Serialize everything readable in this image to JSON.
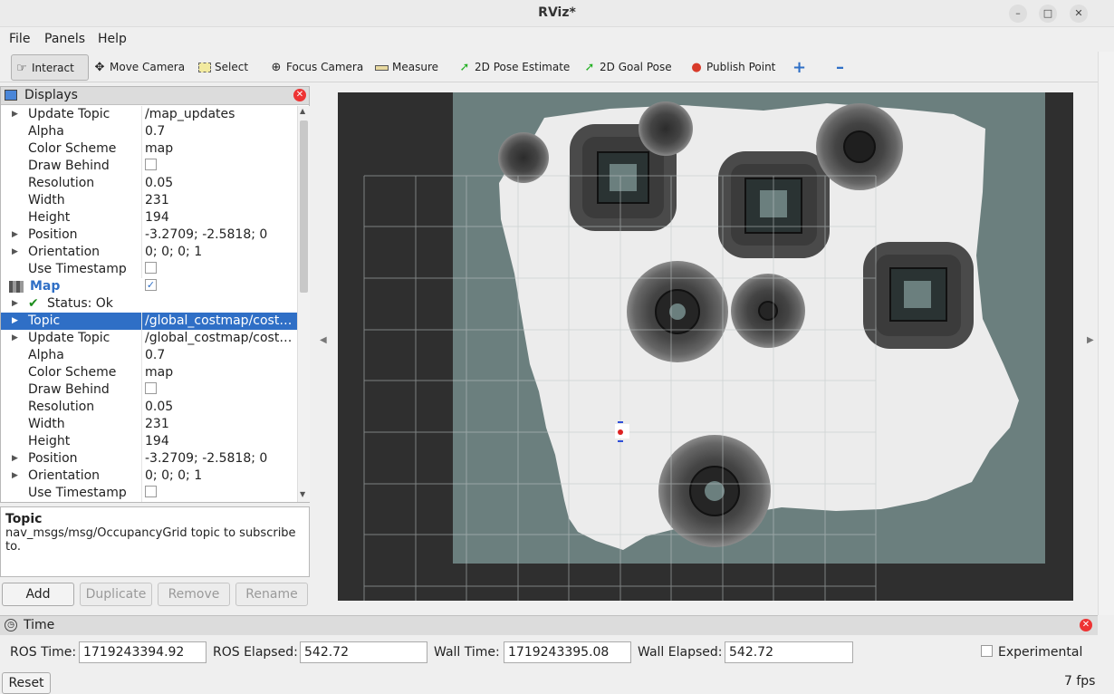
{
  "window": {
    "title": "RViz*"
  },
  "menu": [
    "File",
    "Panels",
    "Help"
  ],
  "toolbar": {
    "interact": "Interact",
    "move_camera": "Move Camera",
    "select": "Select",
    "focus_camera": "Focus Camera",
    "measure": "Measure",
    "pose_estimate": "2D Pose Estimate",
    "goal_pose": "2D Goal Pose",
    "publish_point": "Publish Point"
  },
  "displays": {
    "title": "Displays",
    "rows": [
      {
        "key": "Update Topic",
        "value": "/map_updates",
        "expand": true
      },
      {
        "key": "Alpha",
        "value": "0.7"
      },
      {
        "key": "Color Scheme",
        "value": "map"
      },
      {
        "key": "Draw Behind",
        "value": "",
        "checkbox": false
      },
      {
        "key": "Resolution",
        "value": "0.05"
      },
      {
        "key": "Width",
        "value": "231"
      },
      {
        "key": "Height",
        "value": "194"
      },
      {
        "key": "Position",
        "value": "-3.2709; -2.5818; 0",
        "expand": true
      },
      {
        "key": "Orientation",
        "value": "0; 0; 0; 1",
        "expand": true
      },
      {
        "key": "Use Timestamp",
        "value": "",
        "checkbox": false
      },
      {
        "key": "Map",
        "value": "",
        "checkbox": true,
        "header": true
      },
      {
        "key": "Status: Ok",
        "value": "",
        "status": true,
        "expand": true
      },
      {
        "key": "Topic",
        "value": "/global_costmap/cost…",
        "expand": true,
        "selected": true
      },
      {
        "key": "Update Topic",
        "value": "/global_costmap/cost…",
        "expand": true
      },
      {
        "key": "Alpha",
        "value": "0.7"
      },
      {
        "key": "Color Scheme",
        "value": "map"
      },
      {
        "key": "Draw Behind",
        "value": "",
        "checkbox": false
      },
      {
        "key": "Resolution",
        "value": "0.05"
      },
      {
        "key": "Width",
        "value": "231"
      },
      {
        "key": "Height",
        "value": "194"
      },
      {
        "key": "Position",
        "value": "-3.2709; -2.5818; 0",
        "expand": true
      },
      {
        "key": "Orientation",
        "value": "0; 0; 0; 1",
        "expand": true
      },
      {
        "key": "Use Timestamp",
        "value": "",
        "checkbox": false
      }
    ]
  },
  "description": {
    "title": "Topic",
    "text": "nav_msgs/msg/OccupancyGrid topic to subscribe to."
  },
  "panel_buttons": {
    "add": "Add",
    "duplicate": "Duplicate",
    "remove": "Remove",
    "rename": "Rename"
  },
  "time": {
    "title": "Time",
    "ros_time_label": "ROS Time:",
    "ros_time": "1719243394.92",
    "ros_elapsed_label": "ROS Elapsed:",
    "ros_elapsed": "542.72",
    "wall_time_label": "Wall Time:",
    "wall_time": "1719243395.08",
    "wall_elapsed_label": "Wall Elapsed:",
    "wall_elapsed": "542.72",
    "experimental_label": "Experimental"
  },
  "reset_label": "Reset",
  "fps": "7 fps",
  "colors": {
    "selection": "#2f6fc6",
    "map_bg": "#6b7f7e",
    "free_space": "#ececec",
    "view_bg": "#2f2f2f"
  }
}
